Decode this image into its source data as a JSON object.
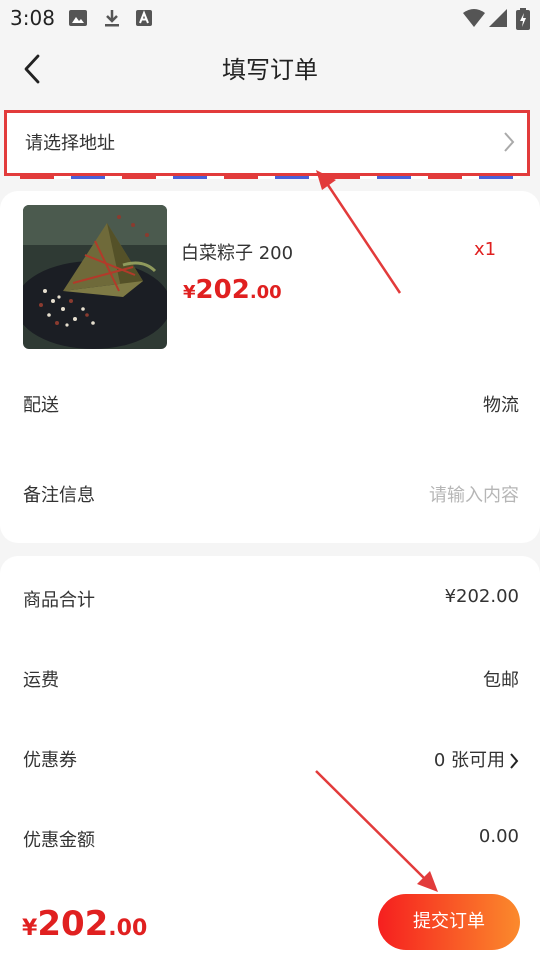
{
  "status_bar": {
    "time": "3:08"
  },
  "header": {
    "title": "填写订单"
  },
  "address": {
    "placeholder": "请选择地址"
  },
  "product": {
    "name": "白菜粽子 200",
    "quantity": "x1",
    "price_symbol": "¥",
    "price_integer": "202",
    "price_decimal": ".00"
  },
  "delivery": {
    "label": "配送",
    "value": "物流"
  },
  "remark": {
    "label": "备注信息",
    "placeholder": "请输入内容"
  },
  "summary": {
    "goods_total_label": "商品合计",
    "goods_total_value": "¥202.00",
    "shipping_label": "运费",
    "shipping_value": "包邮",
    "coupon_label": "优惠券",
    "coupon_value": "0 张可用",
    "discount_label": "优惠金额",
    "discount_value": "0.00"
  },
  "footer": {
    "total_symbol": "¥",
    "total_integer": "202",
    "total_decimal": ".00",
    "submit_label": "提交订单"
  },
  "colors": {
    "accent": "#e02020",
    "annotation": "#e23b3b",
    "button_start": "#f61f1f",
    "button_end": "#fb8a2c"
  }
}
